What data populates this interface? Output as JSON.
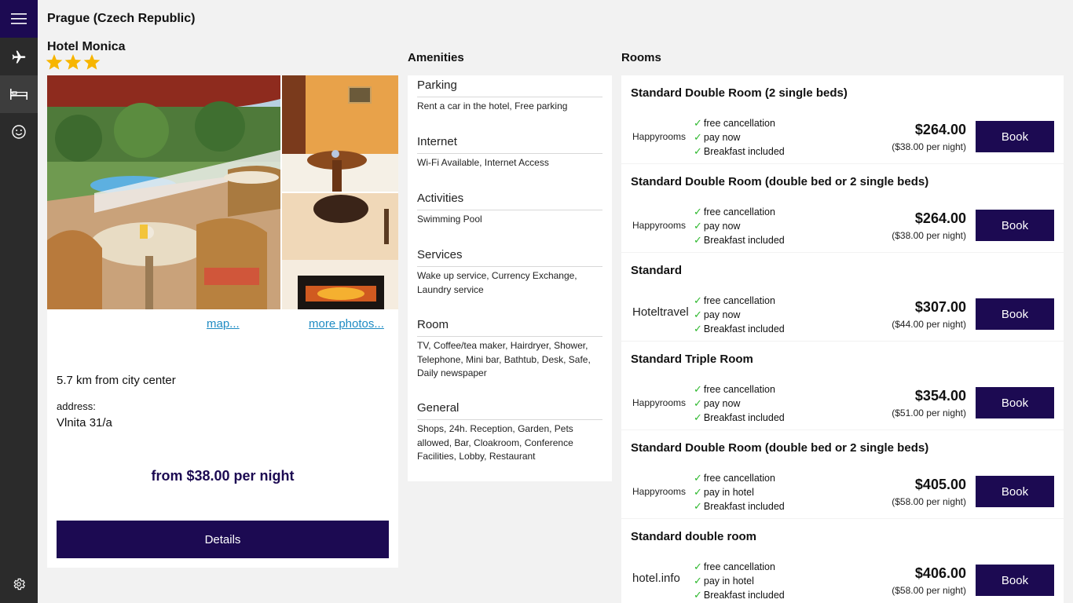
{
  "header": {
    "location": "Prague (Czech Republic)"
  },
  "rail": {
    "accent": "#1c0a52",
    "items": [
      {
        "icon": "hamburger-icon"
      },
      {
        "icon": "airplane-icon"
      },
      {
        "icon": "bed-icon"
      },
      {
        "icon": "smiley-icon"
      },
      {
        "icon": "gear-icon"
      }
    ]
  },
  "hotel": {
    "name": "Hotel Monica",
    "stars": 3,
    "map_link": "map...",
    "photos_link": "more photos...",
    "distance": "5.7 km from city center",
    "address_label": "address:",
    "address": "Vlnita 31/a",
    "price_from": "from $38.00 per night",
    "details_label": "Details"
  },
  "amenities": {
    "heading": "Amenities",
    "sections": [
      {
        "title": "Parking",
        "desc": "Rent a car in the hotel, Free parking"
      },
      {
        "title": "Internet",
        "desc": "Wi-Fi Available, Internet Access"
      },
      {
        "title": "Activities",
        "desc": "Swimming Pool"
      },
      {
        "title": "Services",
        "desc": "Wake up service, Currency Exchange, Laundry service"
      },
      {
        "title": "Room",
        "desc": "TV, Coffee/tea maker, Hairdryer, Shower, Telephone, Mini bar, Bathtub, Desk, Safe, Daily newspaper"
      },
      {
        "title": "General",
        "desc": "Shops, 24h. Reception, Garden, Pets allowed, Bar, Cloakroom, Conference Facilities, Lobby, Restaurant"
      }
    ]
  },
  "rooms": {
    "heading": "Rooms",
    "book_label": "Book",
    "items": [
      {
        "name": "Standard Double Room (2 single beds)",
        "provider": "Happyrooms",
        "features": [
          "free cancellation",
          "pay now",
          "Breakfast included"
        ],
        "price": "$264.00",
        "per_night": "($38.00 per night)"
      },
      {
        "name": "Standard Double Room (double bed or 2 single beds)",
        "provider": "Happyrooms",
        "features": [
          "free cancellation",
          "pay now",
          "Breakfast included"
        ],
        "price": "$264.00",
        "per_night": "($38.00 per night)"
      },
      {
        "name": "Standard",
        "provider": "Hoteltravel",
        "features": [
          "free cancellation",
          "pay now",
          "Breakfast included"
        ],
        "price": "$307.00",
        "per_night": "($44.00 per night)"
      },
      {
        "name": "Standard Triple Room",
        "provider": "Happyrooms",
        "features": [
          "free cancellation",
          "pay now",
          "Breakfast included"
        ],
        "price": "$354.00",
        "per_night": "($51.00 per night)"
      },
      {
        "name": "Standard Double Room (double bed or 2 single beds)",
        "provider": "Happyrooms",
        "features": [
          "free cancellation",
          "pay in hotel",
          "Breakfast included"
        ],
        "price": "$405.00",
        "per_night": "($58.00 per night)"
      },
      {
        "name": "Standard double room",
        "provider": "hotel.info",
        "features": [
          "free cancellation",
          "pay in hotel",
          "Breakfast included"
        ],
        "price": "$406.00",
        "per_night": "($58.00 per night)"
      }
    ]
  }
}
